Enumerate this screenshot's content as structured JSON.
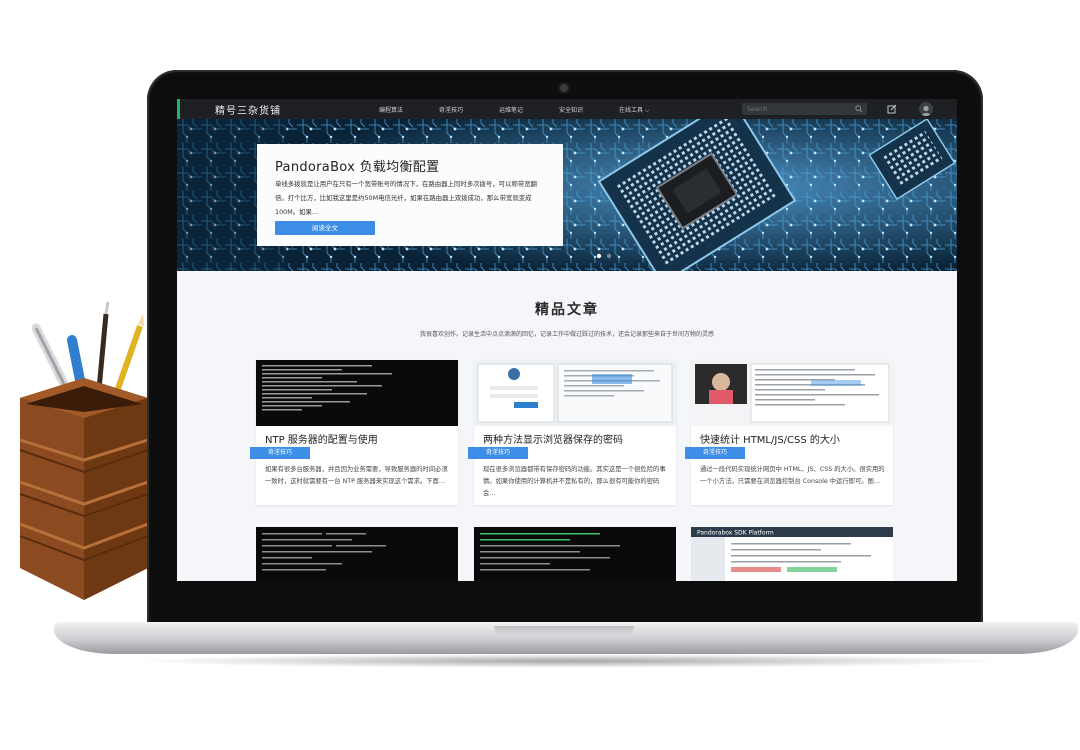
{
  "site": {
    "logo": "精号三杂货铺",
    "nav_items": [
      "编程算法",
      "奇淫技巧",
      "运维笔记",
      "安全知识",
      "在线工具 ⌵"
    ],
    "search_placeholder": "Search"
  },
  "hero": {
    "title": "PandoraBox 负载均衡配置",
    "text": "单线多拨就是让用户在只有一个宽带账号的情况下，在路由器上同时多次拨号，可以称带宽翻倍。打个比方，比如我这里是约50M电信光纤，如果在路由器上双拨成功，那么带宽就变成100M。如果…",
    "button": "阅读全文"
  },
  "section": {
    "title": "精品文章",
    "subtitle": "我很喜欢创作。记录生活中点点滴滴的回忆，记录工作中做过踩过的技术，还会记录那些来自于世间万物的灵感"
  },
  "articles": [
    {
      "title": "NTP 服务器的配置与使用",
      "tag": "奇淫技巧",
      "excerpt": "如果有很多台服务器，并且因为业务需要，导致服务器的时间必须一致时，这时就需要有一台 NTP 服务器来实现这个需求。下面…"
    },
    {
      "title": "两种方法显示浏览器保存的密码",
      "tag": "奇淫技巧",
      "excerpt": "现在很多浏览器都带有保存密码的功能。其实这是一个很危险的事情。如果你使用的计算机并不是私有的，那么很有可能你的密码会…"
    },
    {
      "title": "快速统计 HTML/JS/CSS 的大小",
      "tag": "奇淫技巧",
      "excerpt": "通过一段代码实现统计网页中 HTML、JS、CSS 的大小。很实用的一个小方法。只需要在浏览器控制台 Console 中运行即可。图…"
    }
  ],
  "second_row": [
    {
      "thumb_text": ""
    },
    {
      "thumb_text": ""
    },
    {
      "thumb_text": "Pandorabox SDK Platform"
    }
  ],
  "colors": {
    "accent": "#3d8ee6",
    "nav_bg": "#1e2023",
    "page_bg": "#f4f6f9"
  }
}
